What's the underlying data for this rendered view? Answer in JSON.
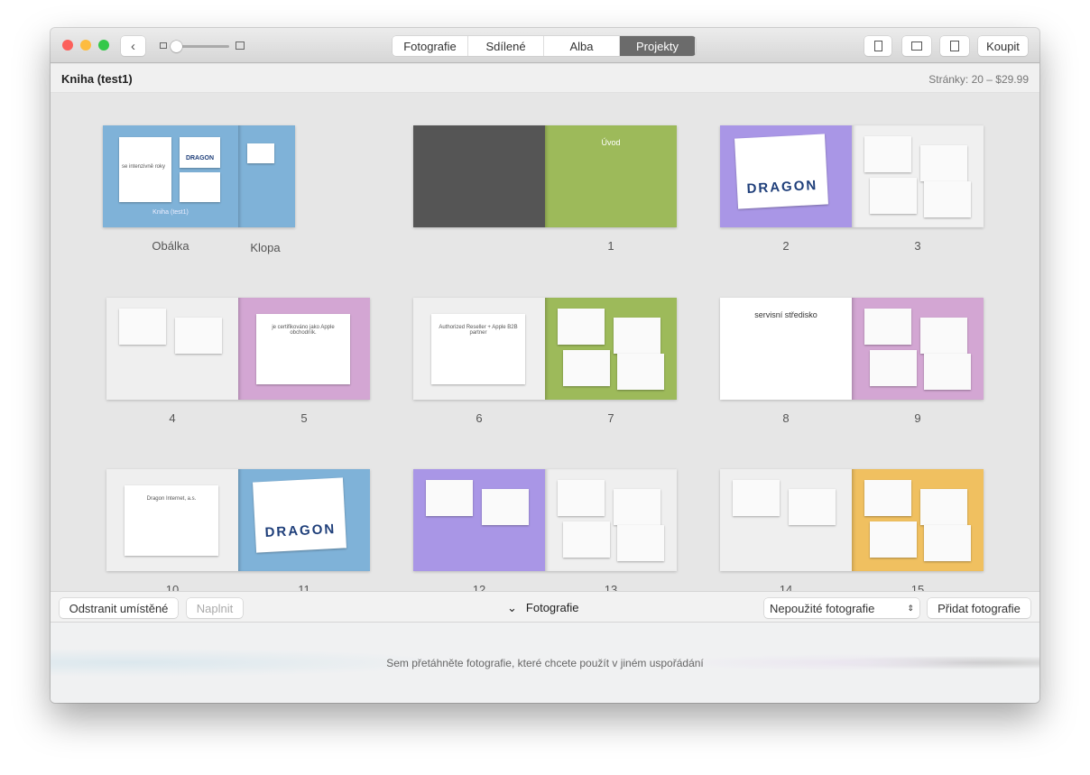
{
  "toolbar": {
    "tabs": [
      {
        "label": "Fotografie",
        "active": false
      },
      {
        "label": "Sdílené",
        "active": false
      },
      {
        "label": "Alba",
        "active": false
      },
      {
        "label": "Projekty",
        "active": true
      }
    ],
    "buy_label": "Koupit"
  },
  "header": {
    "title": "Kniha (test1)",
    "info": "Stránky: 20 – $29.99"
  },
  "cover": {
    "labels": [
      "Obálka",
      "Klopa"
    ],
    "color": "#7fb2d8",
    "cover_text": "se intenzivně roky",
    "logo": "DRAGON",
    "book_title": "Kniha (test1)"
  },
  "spreads": [
    {
      "pages": [
        {
          "label": "",
          "color": "#555555"
        },
        {
          "label": "1",
          "color": "#9dba5a",
          "title": "Úvod"
        }
      ]
    },
    {
      "pages": [
        {
          "label": "2",
          "color": "#a996e6",
          "logo": "DRAGON"
        },
        {
          "label": "3",
          "color": "#f0f0f0"
        }
      ]
    },
    {
      "pages": [
        {
          "label": "4",
          "color": "#efefef"
        },
        {
          "label": "5",
          "color": "#d3a6d3",
          "caption": "je certifikováno jako Apple obchodník."
        }
      ]
    },
    {
      "pages": [
        {
          "label": "6",
          "color": "#efefef",
          "caption": "Authorized Reseller + Apple B2B partner"
        },
        {
          "label": "7",
          "color": "#9dba5a"
        }
      ]
    },
    {
      "pages": [
        {
          "label": "8",
          "color": "#ffffff",
          "title": "servisní středisko"
        },
        {
          "label": "9",
          "color": "#d3a6d3"
        }
      ]
    },
    {
      "pages": [
        {
          "label": "10",
          "color": "#efefef",
          "caption": "Dragon Internet, a.s."
        },
        {
          "label": "11",
          "color": "#7fb2d8",
          "logo": "DRAGON"
        }
      ]
    },
    {
      "pages": [
        {
          "label": "12",
          "color": "#a996e6"
        },
        {
          "label": "13",
          "color": "#efefef"
        }
      ]
    },
    {
      "pages": [
        {
          "label": "14",
          "color": "#efefef"
        },
        {
          "label": "15",
          "color": "#f0c060"
        }
      ]
    }
  ],
  "bottom": {
    "remove_label": "Odstranit umístěné",
    "fill_label": "Naplnit",
    "photos_label": "Fotografie",
    "filter_value": "Nepoužité fotografie",
    "add_label": "Přidat fotografie",
    "drop_hint": "Sem přetáhněte fotografie, které chcete použít v jiném uspořádání"
  }
}
